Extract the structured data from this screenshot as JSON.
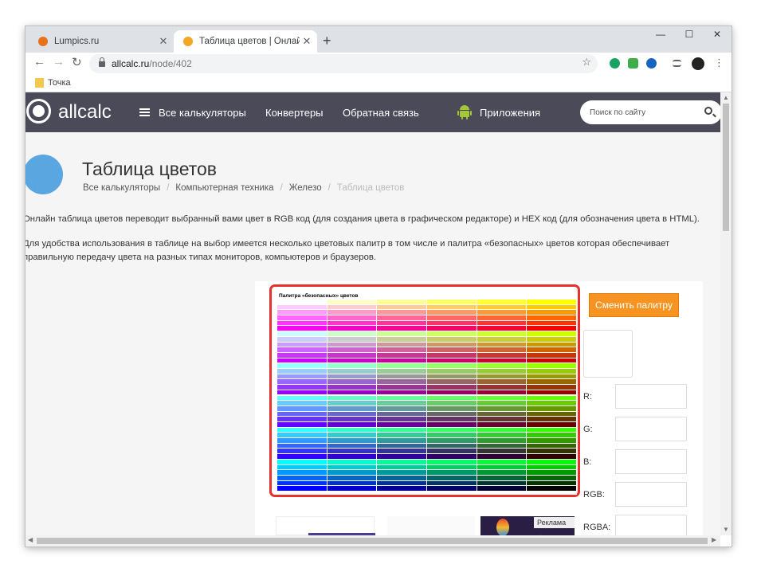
{
  "browser": {
    "tabs": [
      {
        "title": "Lumpics.ru",
        "favicon_color": "#e8711c"
      },
      {
        "title": "Таблица цветов | Онлайн кальк",
        "favicon_color": "#f5a623"
      }
    ],
    "new_tab": "+",
    "window_controls": {
      "minimize": "—",
      "maximize": "☐",
      "close": "✕"
    },
    "url_host": "allcalc.ru",
    "url_path": "/node/402",
    "bookmark_label": "Точка"
  },
  "site": {
    "logo": "allcalc",
    "nav": [
      {
        "label": "Все калькуляторы"
      },
      {
        "label": "Конвертеры"
      },
      {
        "label": "Обратная связь"
      },
      {
        "label": "Приложения"
      }
    ],
    "search_placeholder": "Поиск по сайту"
  },
  "page": {
    "title": "Таблица цветов",
    "breadcrumbs": [
      "Все калькуляторы",
      "Компьютерная техника",
      "Железо",
      "Таблица цветов"
    ],
    "paragraphs": [
      "Онлайн таблица цветов переводит выбранный вами цвет в RGB код (для создания цвета в графическом редакторе) и HEX код (для обозначения цвета в HTML).",
      "Для удобства использования в таблице на выбор имеется несколько цветовых палитр в том числе и палитра «безопасных» цветов которая обеспечивает",
      "правильную передачу цвета на разных типах мониторов, компьютеров и браузеров."
    ]
  },
  "tool": {
    "palette_caption": "Палитра «безопасных» цветов",
    "change_palette_button": "Сменить палитру",
    "fields": [
      {
        "label": "R:",
        "value": ""
      },
      {
        "label": "G:",
        "value": ""
      },
      {
        "label": "B:",
        "value": ""
      },
      {
        "label": "RGB:",
        "value": ""
      },
      {
        "label": "RGBA:",
        "value": ""
      }
    ]
  },
  "ad": {
    "label": "Реклама ⌄"
  }
}
